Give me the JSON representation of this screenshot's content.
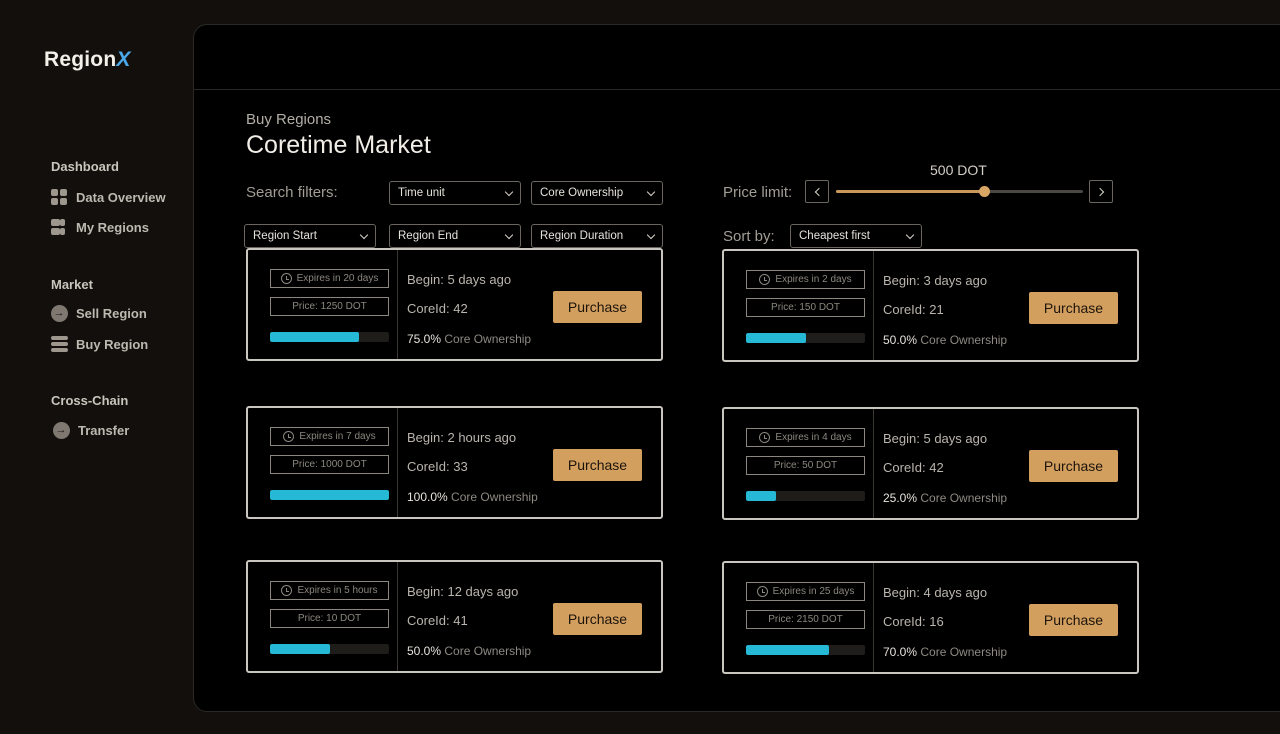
{
  "app": {
    "logo_main": "Region",
    "logo_x": "X"
  },
  "sidebar": {
    "sections": [
      {
        "title": "Dashboard",
        "items": [
          {
            "label": "Data Overview",
            "icon": "grid-icon"
          },
          {
            "label": "My Regions",
            "icon": "regions-icon"
          }
        ]
      },
      {
        "title": "Market",
        "items": [
          {
            "label": "Sell Region",
            "icon": "arrow-right-circle-icon"
          },
          {
            "label": "Buy Region",
            "icon": "stack-icon"
          }
        ]
      },
      {
        "title": "Cross-Chain",
        "items": [
          {
            "label": "Transfer",
            "icon": "arrow-right-circle-icon"
          }
        ]
      }
    ]
  },
  "header": {
    "breadcrumb": "Buy Regions",
    "title": "Coretime Market"
  },
  "filters": {
    "search_label": "Search filters:",
    "time_unit": "Time unit",
    "core_ownership": "Core Ownership",
    "region_start": "Region Start",
    "region_end": "Region End",
    "region_duration": "Region Duration",
    "price_limit_label": "Price limit:",
    "price_limit_value": "500 DOT",
    "price_limit_fraction": 0.6,
    "sort_label": "Sort by:",
    "sort_value": "Cheapest first"
  },
  "colors": {
    "accent": "#d39f5f",
    "progress": "#25b9d6",
    "background": "#000000"
  },
  "cards": [
    {
      "expires": "Expires in 20 days",
      "price": "Price: 1250 DOT",
      "begin": "Begin: 5 days ago",
      "core": "CoreId: 42",
      "ownership_pct": "75.0%",
      "ownership_label": "Core Ownership",
      "ownership_value": 75,
      "purchase": "Purchase"
    },
    {
      "expires": "Expires in 2 days",
      "price": "Price: 150 DOT",
      "begin": "Begin: 3 days ago",
      "core": "CoreId: 21",
      "ownership_pct": "50.0%",
      "ownership_label": "Core Ownership",
      "ownership_value": 50,
      "purchase": "Purchase"
    },
    {
      "expires": "Expires in 7 days",
      "price": "Price: 1000 DOT",
      "begin": "Begin: 2 hours ago",
      "core": "CoreId: 33",
      "ownership_pct": "100.0%",
      "ownership_label": "Core Ownership",
      "ownership_value": 100,
      "purchase": "Purchase"
    },
    {
      "expires": "Expires in 4 days",
      "price": "Price: 50 DOT",
      "begin": "Begin: 5 days ago",
      "core": "CoreId: 42",
      "ownership_pct": "25.0%",
      "ownership_label": "Core Ownership",
      "ownership_value": 25,
      "purchase": "Purchase"
    },
    {
      "expires": "Expires in 5 hours",
      "price": "Price: 10 DOT",
      "begin": "Begin: 12 days ago",
      "core": "CoreId: 41",
      "ownership_pct": "50.0%",
      "ownership_label": "Core Ownership",
      "ownership_value": 50,
      "purchase": "Purchase"
    },
    {
      "expires": "Expires in 25 days",
      "price": "Price: 2150 DOT",
      "begin": "Begin: 4 days ago",
      "core": "CoreId: 16",
      "ownership_pct": "70.0%",
      "ownership_label": "Core Ownership",
      "ownership_value": 70,
      "purchase": "Purchase"
    }
  ]
}
